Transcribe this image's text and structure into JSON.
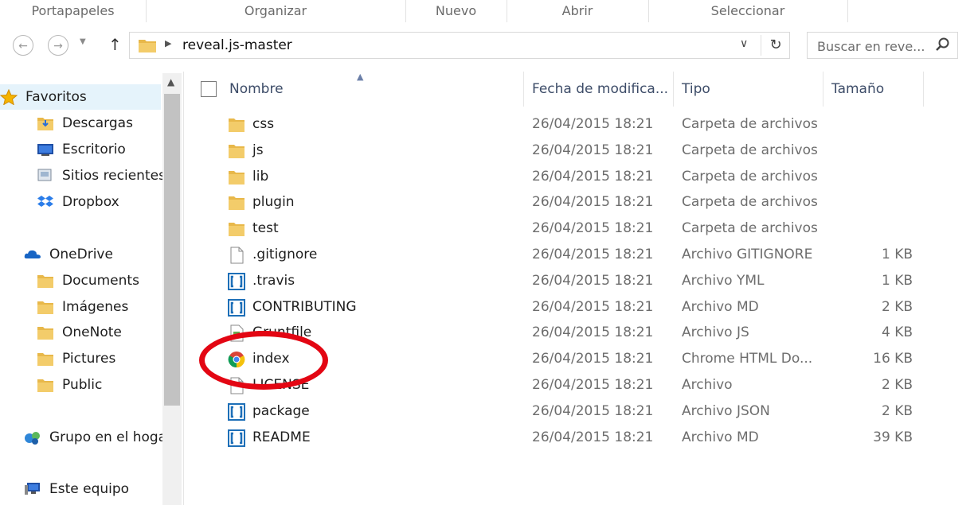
{
  "ribbon": {
    "groups": [
      "Portapapeles",
      "Organizar",
      "Nuevo",
      "Abrir",
      "Seleccionar"
    ]
  },
  "address": {
    "path": "reveal.js-master"
  },
  "search": {
    "placeholder": "Buscar en reve..."
  },
  "nav": {
    "favorites": "Favoritos",
    "favorites_items": [
      "Descargas",
      "Escritorio",
      "Sitios recientes",
      "Dropbox"
    ],
    "onedrive": "OneDrive",
    "onedrive_items": [
      "Documents",
      "Imágenes",
      "OneNote",
      "Pictures",
      "Public"
    ],
    "homegroup": "Grupo en el hoga",
    "thispc": "Este equipo"
  },
  "columns": {
    "name": "Nombre",
    "date": "Fecha de modifica...",
    "type": "Tipo",
    "size": "Tamaño"
  },
  "files": [
    {
      "name": "css",
      "date": "26/04/2015 18:21",
      "type": "Carpeta de archivos",
      "size": "",
      "icon": "folder-icon"
    },
    {
      "name": "js",
      "date": "26/04/2015 18:21",
      "type": "Carpeta de archivos",
      "size": "",
      "icon": "folder-icon"
    },
    {
      "name": "lib",
      "date": "26/04/2015 18:21",
      "type": "Carpeta de archivos",
      "size": "",
      "icon": "folder-icon"
    },
    {
      "name": "plugin",
      "date": "26/04/2015 18:21",
      "type": "Carpeta de archivos",
      "size": "",
      "icon": "folder-icon"
    },
    {
      "name": "test",
      "date": "26/04/2015 18:21",
      "type": "Carpeta de archivos",
      "size": "",
      "icon": "folder-icon"
    },
    {
      "name": ".gitignore",
      "date": "26/04/2015 18:21",
      "type": "Archivo GITIGNORE",
      "size": "1 KB",
      "icon": "blank-file-icon"
    },
    {
      "name": ".travis",
      "date": "26/04/2015 18:21",
      "type": "Archivo YML",
      "size": "1 KB",
      "icon": "code-file-icon"
    },
    {
      "name": "CONTRIBUTING",
      "date": "26/04/2015 18:21",
      "type": "Archivo MD",
      "size": "2 KB",
      "icon": "code-file-icon"
    },
    {
      "name": "Gruntfile",
      "date": "26/04/2015 18:21",
      "type": "Archivo JS",
      "size": "4 KB",
      "icon": "script-file-icon"
    },
    {
      "name": "index",
      "date": "26/04/2015 18:21",
      "type": "Chrome HTML Do...",
      "size": "16 KB",
      "icon": "chrome-icon"
    },
    {
      "name": "LICENSE",
      "date": "26/04/2015 18:21",
      "type": "Archivo",
      "size": "2 KB",
      "icon": "blank-file-icon"
    },
    {
      "name": "package",
      "date": "26/04/2015 18:21",
      "type": "Archivo JSON",
      "size": "2 KB",
      "icon": "code-file-icon"
    },
    {
      "name": "README",
      "date": "26/04/2015 18:21",
      "type": "Archivo MD",
      "size": "39 KB",
      "icon": "code-file-icon"
    }
  ],
  "colors": {
    "highlight": "#e30613",
    "header_text": "#3d4c68",
    "folder": "#e8b84a"
  }
}
